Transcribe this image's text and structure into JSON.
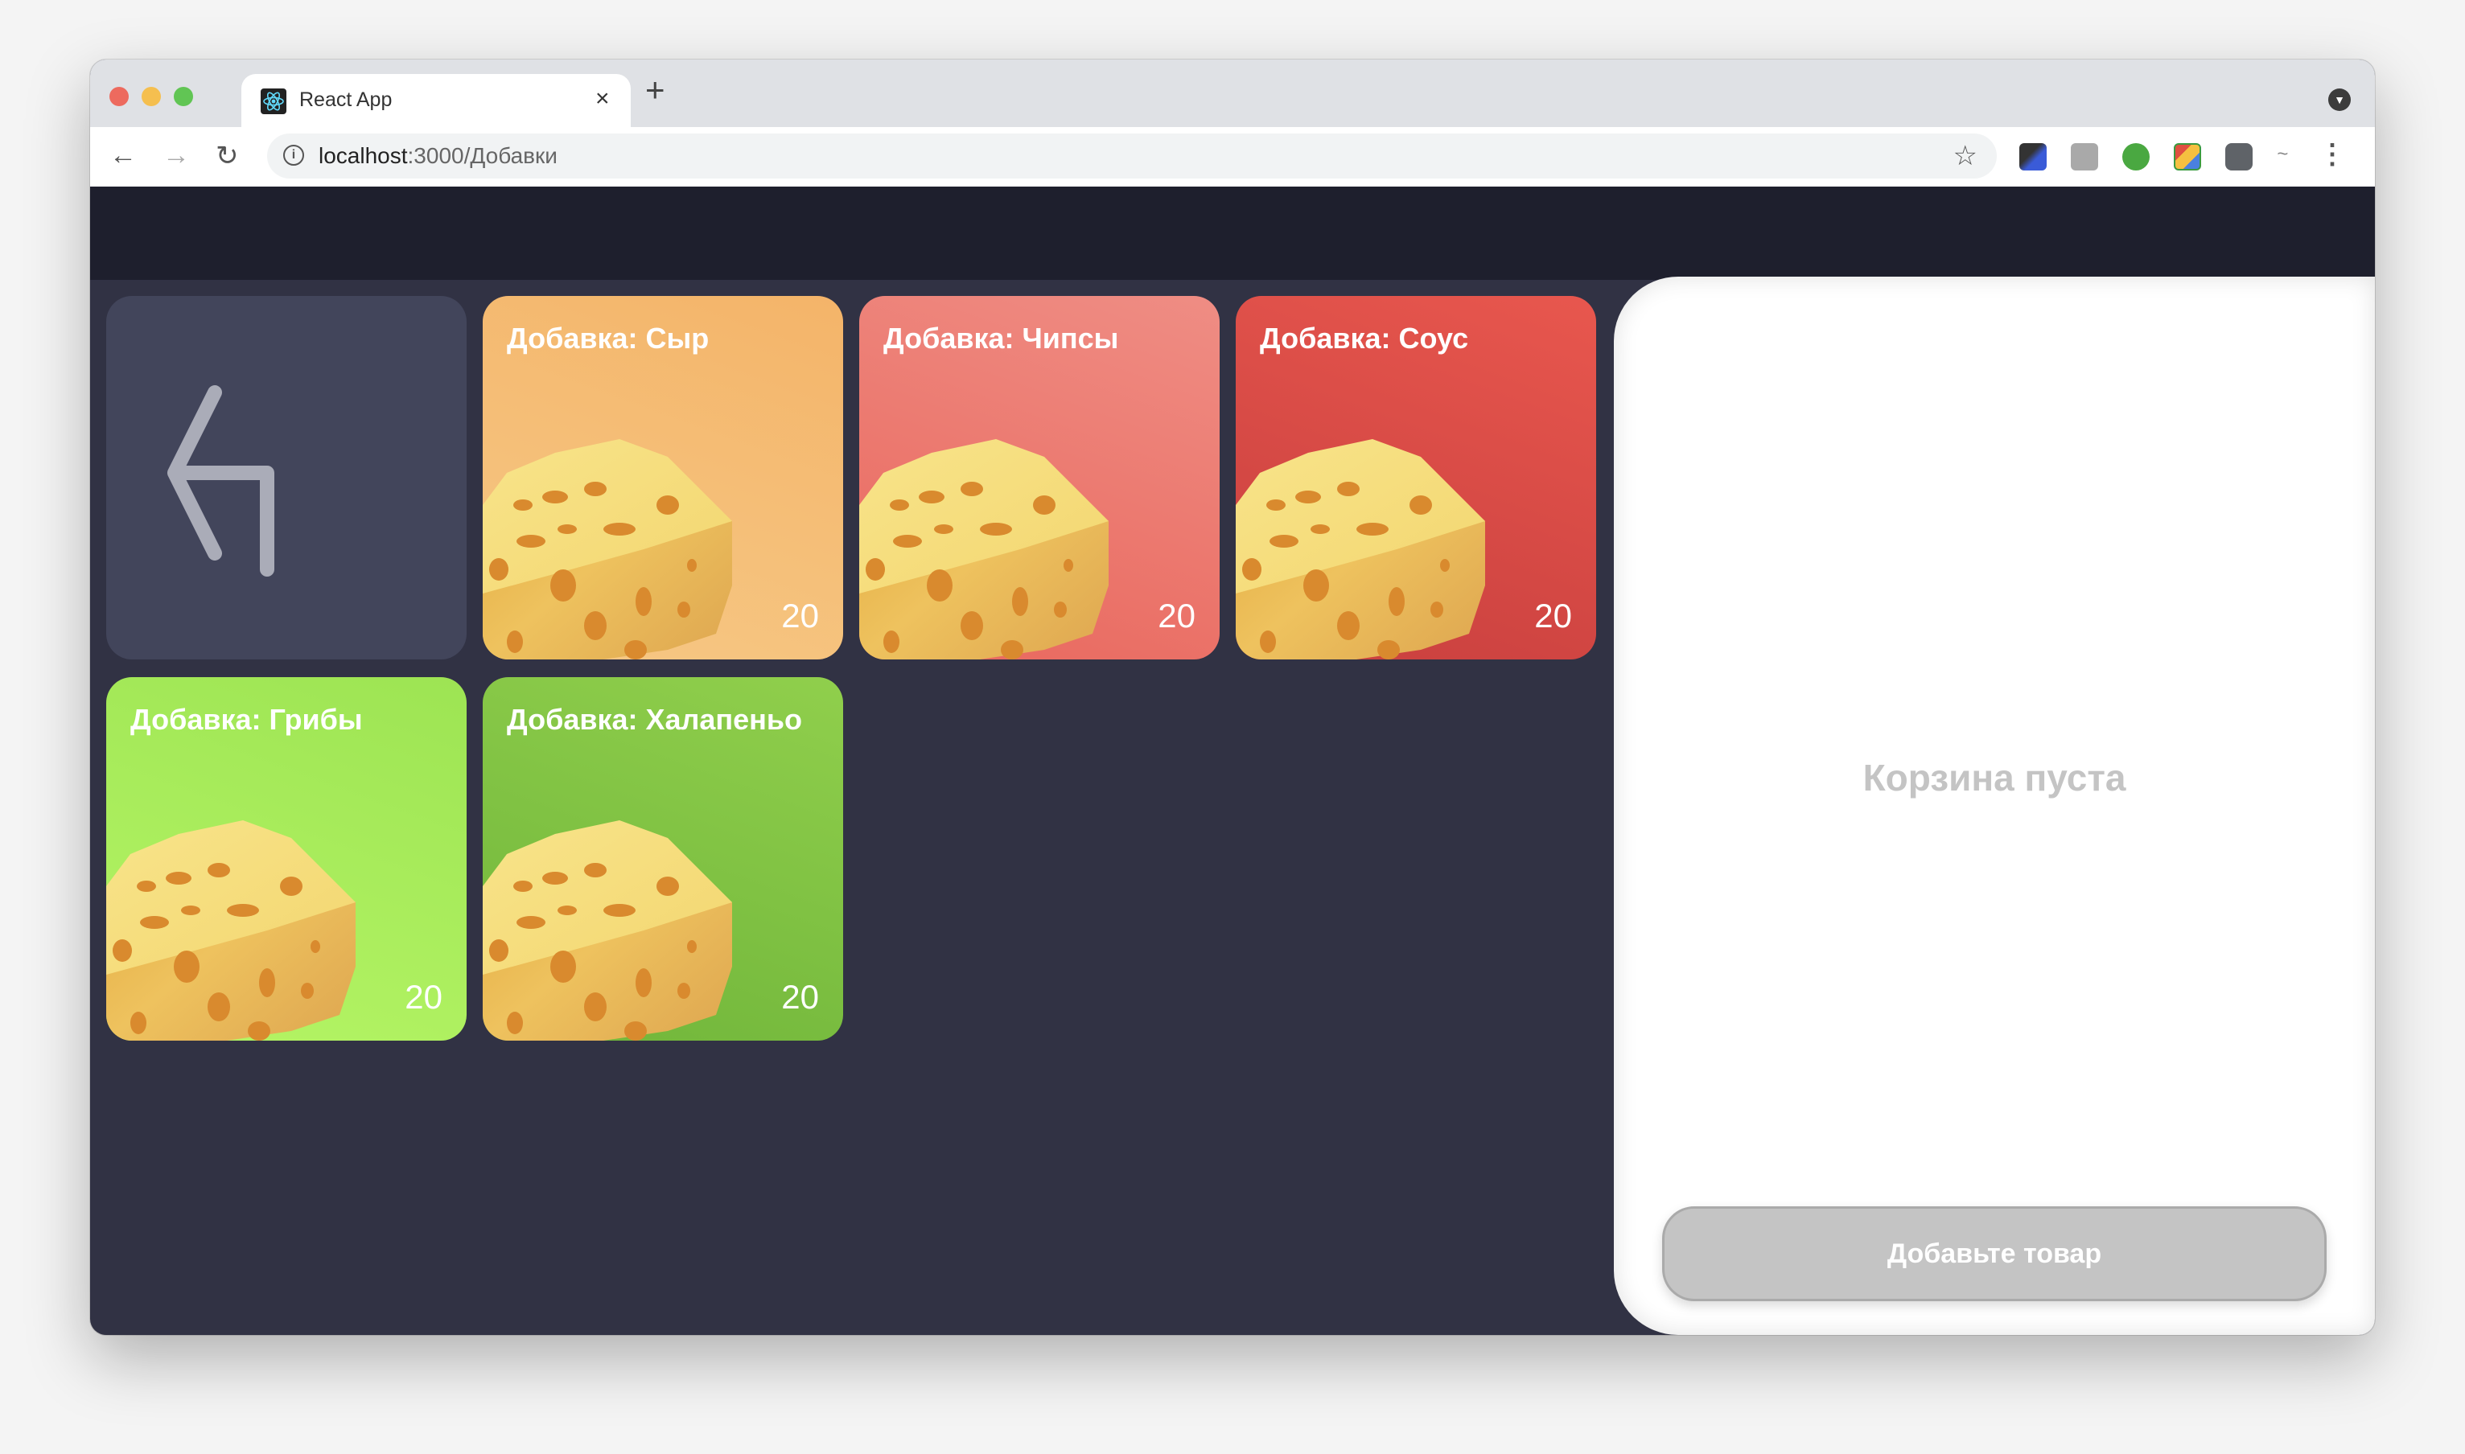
{
  "browser": {
    "tab_title": "React App",
    "url_host": "localhost",
    "url_path": ":3000/Добавки",
    "icons": [
      "react-favicon",
      "close-icon",
      "plus-icon",
      "profile-dropdown-icon",
      "back-arrow-icon",
      "forward-arrow-icon",
      "reload-icon",
      "info-icon",
      "star-icon",
      "eyedropper-extension-icon",
      "touch-extension-icon",
      "evernote-extension-icon",
      "screenshot-extension-icon",
      "puzzle-extension-icon",
      "signature-extension-icon",
      "kebab-menu-icon"
    ]
  },
  "products": {
    "back_icon": "return-arrow-icon",
    "items": [
      {
        "title": "Добавка: Сыр",
        "price": "20",
        "color_from": "#f4b469",
        "color_to": "#f6c885"
      },
      {
        "title": "Добавка: Чипсы",
        "price": "20",
        "color_from": "#ef8d84",
        "color_to": "#e9675d"
      },
      {
        "title": "Добавка: Соус",
        "price": "20",
        "color_from": "#e8574e",
        "color_to": "#c83f3e"
      },
      {
        "title": "Добавка: Грибы",
        "price": "20",
        "color_from": "#9de453",
        "color_to": "#b5f565"
      },
      {
        "title": "Добавка: Халапеньо",
        "price": "20",
        "color_from": "#90cf4c",
        "color_to": "#70b53a"
      }
    ]
  },
  "cart": {
    "empty_text": "Корзина пуста",
    "add_button": "Добавьте товар"
  }
}
